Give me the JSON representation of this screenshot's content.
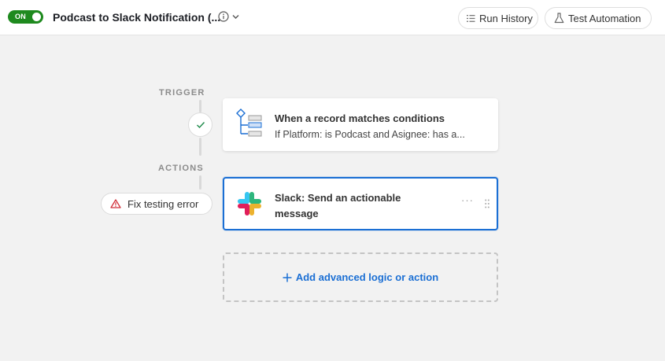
{
  "header": {
    "toggle_label": "ON",
    "automation_title": "Podcast to Slack Notification (...",
    "run_history_label": "Run History",
    "test_automation_label": "Test Automation"
  },
  "flow": {
    "trigger_label": "TRIGGER",
    "actions_label": "ACTIONS",
    "trigger_card": {
      "title": "When a record matches conditions",
      "subtitle": "If Platform: is Podcast and Asignee: has a..."
    },
    "action_card": {
      "title": "Slack: Send an actionable message",
      "more_label": "···"
    },
    "fix_error_label": "Fix testing error",
    "add_action_label": "Add advanced logic or action"
  },
  "icons": {
    "toggle": "toggle-switch",
    "info": "info-icon",
    "dropdown": "chevron-down-icon",
    "run_history": "list-icon",
    "test": "flask-icon",
    "status": "check-icon",
    "trigger": "record-conditions-icon",
    "action": "slack-icon",
    "warning": "warning-icon",
    "drag": "drag-handle-icon",
    "add": "plus-icon"
  },
  "colors": {
    "toggle_on": "#1e8a1e",
    "selected_border": "#1b6fd4",
    "link_blue": "#1b6fd4",
    "warning_red": "#d12f3a",
    "check_green": "#1e8a4a"
  }
}
